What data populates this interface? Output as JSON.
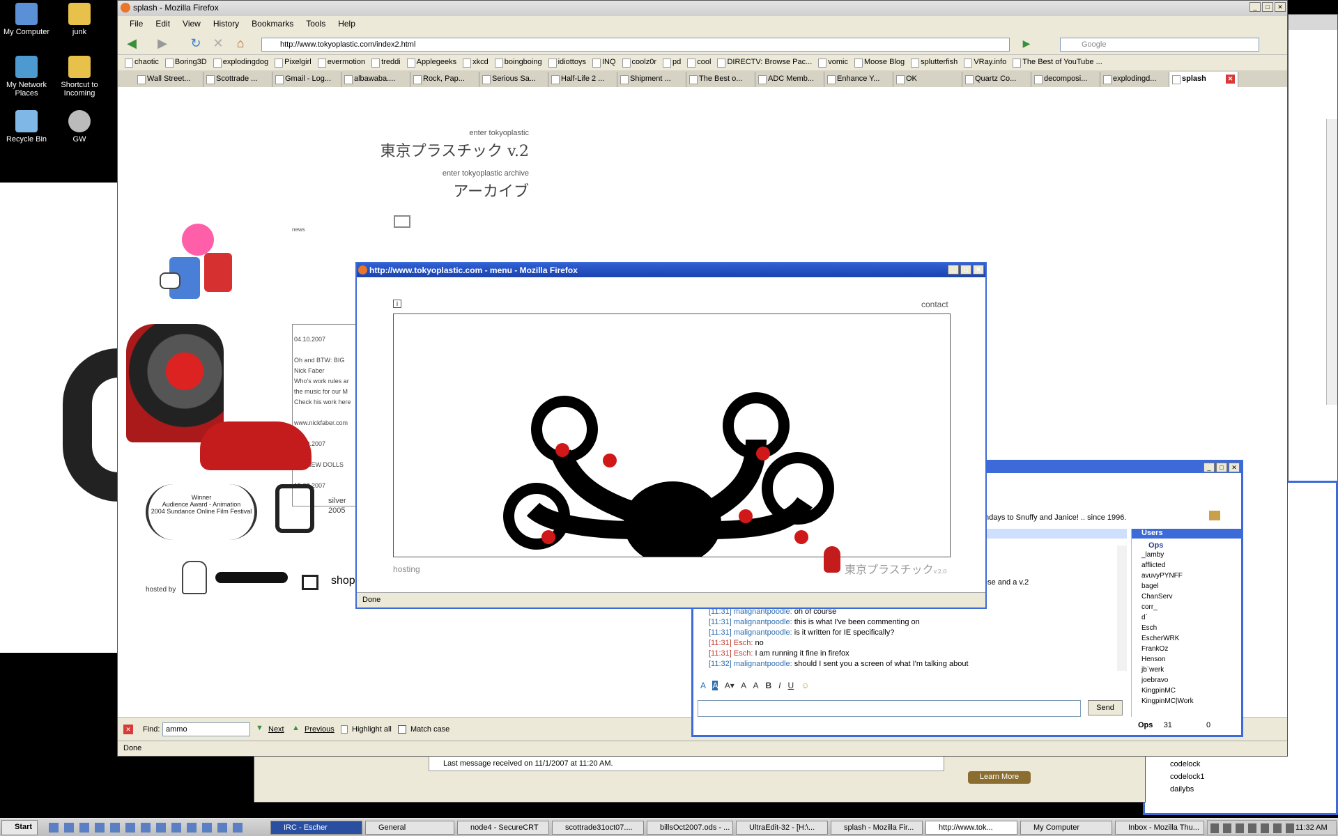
{
  "desktop": {
    "icons": [
      {
        "label": "My Computer"
      },
      {
        "label": "junk"
      },
      {
        "label": "My Network Places"
      },
      {
        "label": "Shortcut to Incoming"
      },
      {
        "label": "Recycle Bin"
      },
      {
        "label": "GW"
      }
    ]
  },
  "firefox": {
    "title": "splash - Mozilla Firefox",
    "menu": [
      "File",
      "Edit",
      "View",
      "History",
      "Bookmarks",
      "Tools",
      "Help"
    ],
    "url": "http://www.tokyoplastic.com/index2.html",
    "search_placeholder": "Google",
    "bookmarks": [
      "chaotic",
      "Boring3D",
      "explodingdog",
      "Pixelgirl",
      "evermotion",
      "treddi",
      "Applegeeks",
      "xkcd",
      "boingboing",
      "idiottoys",
      "INQ",
      "coolz0r",
      "pd",
      "cool",
      "DIRECTV: Browse Pac...",
      "vomic",
      "Moose Blog",
      "splutterfish",
      "VRay.info",
      "The Best of YouTube ..."
    ],
    "tabs": [
      "Wall Street...",
      "Scottrade ...",
      "Gmail - Log...",
      "albawaba....",
      "Rock, Pap...",
      "Serious Sa...",
      "Half-Life 2 ...",
      "Shipment ...",
      "The Best o...",
      "ADC Memb...",
      "Enhance Y...",
      "OK",
      "Quartz Co...",
      "decomposi...",
      "explodingd...",
      "splash"
    ],
    "find_label": "Find:",
    "find_value": "ammo",
    "find_next": "Next",
    "find_previous": "Previous",
    "find_highlight": "Highlight all",
    "find_matchcase": "Match case",
    "status": "Done"
  },
  "page": {
    "enter_v2": "enter tokyoplastic",
    "v2_jp": "東京プラスチック v.2",
    "enter_archive": "enter tokyoplastic archive",
    "archive_jp": "アーカイブ",
    "news_label": "news",
    "news_lines": [
      "04.10.2007",
      "",
      "Oh and BTW: BIG",
      "Nick Faber",
      "Who's work rules ar",
      "the music for our M",
      "Check his work here",
      "",
      "www.nickfaber.com",
      "",
      "10.09.2007",
      "",
      "BIG NEW DOLLS",
      "",
      "15.08.2007"
    ],
    "award_winner": "Winner",
    "award_title": "Audience Award - Animation",
    "award_sub": "2004 Sundance Online Film Festival",
    "dad_silver": "silver",
    "dad_year": "2005",
    "hosted_by": "hosted by",
    "shop": "shop"
  },
  "popup": {
    "title": "http://www.tokyoplastic.com - menu - Mozilla Firefox",
    "info": "i",
    "contact": "contact",
    "hosting": "hosting",
    "logo": "東京プラスチック",
    "logo_ver": "v.2.0",
    "status": "Done"
  },
  "irc": {
    "topic": "ndays to Snuffy and Janice!  .. since 1996.",
    "partial_line": "ese and a v.2",
    "messages": [
      {
        "time": "[11:31]",
        "nick": "malignantpoodle:",
        "text": "oh of course",
        "type": "mp"
      },
      {
        "time": "[11:31]",
        "nick": "malignantpoodle:",
        "text": "this is what I've been commenting on",
        "type": "mp"
      },
      {
        "time": "[11:31]",
        "nick": "malignantpoodle:",
        "text": "is it written for IE specifically?",
        "type": "mp"
      },
      {
        "time": "[11:31]",
        "nick": "Esch:",
        "text": "no",
        "type": "esch"
      },
      {
        "time": "[11:31]",
        "nick": "Esch:",
        "text": "I am running it fine in firefox",
        "type": "esch"
      },
      {
        "time": "[11:32]",
        "nick": "malignantpoodle:",
        "text": "should I sent you a screen of what I'm talking about",
        "type": "mp"
      }
    ],
    "send": "Send",
    "users_title": "Users",
    "ops_group": "Ops",
    "users": [
      "_lamby",
      "afflicted",
      "avuvyPYNFF",
      "bagel",
      "ChanServ",
      "corr_",
      "d`",
      "Esch",
      "EscherWRK",
      "FrankOz",
      "Henson",
      "jb`werk",
      "joebravo",
      "KingpinMC",
      "KingpinMC|Work"
    ],
    "ops_label": "Ops",
    "ops_count": "31",
    "other_count": "0"
  },
  "behind": {
    "last_message": "Last message received on 11/1/2007 at 11:20 AM.",
    "learn_more": "Learn More",
    "folders": [
      "codelock",
      "codelock1",
      "dailybs"
    ]
  },
  "taskbar": {
    "start": "Start",
    "buttons": [
      "IRC - Escher",
      "General",
      "node4 - SecureCRT",
      "scottrade31oct07....",
      "billsOct2007.ods - ...",
      "UltraEdit-32 - [H:\\...",
      "splash - Mozilla Fir...",
      "http://www.tok...",
      "My Computer",
      "Inbox - Mozilla Thu..."
    ],
    "clock": "11:32 AM"
  }
}
